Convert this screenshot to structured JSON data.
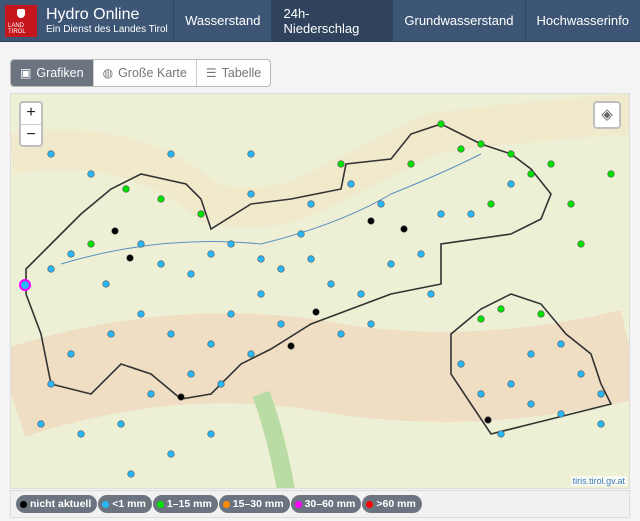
{
  "header": {
    "logo_text": "LAND TIROL",
    "title": "Hydro Online",
    "subtitle": "Ein Dienst des Landes Tirol",
    "nav": [
      {
        "label": "Wasserstand"
      },
      {
        "label": "24h-Niederschlag",
        "active": true
      },
      {
        "label": "Grundwasserstand"
      },
      {
        "label": "Hochwasserinfo"
      }
    ]
  },
  "tabs": [
    {
      "label": "Grafiken",
      "icon": "image-icon",
      "active": true
    },
    {
      "label": "Große Karte",
      "icon": "globe-icon"
    },
    {
      "label": "Tabelle",
      "icon": "list-icon"
    }
  ],
  "map": {
    "zoom_in": "+",
    "zoom_out": "−",
    "attribution": "tiris.tirol.gv.at",
    "layers_icon": "layers-icon"
  },
  "legend": [
    {
      "label": "nicht aktuell",
      "color": "#000000"
    },
    {
      "label": "<1 mm",
      "color": "#29b6f6"
    },
    {
      "label": "1–15 mm",
      "color": "#00e000"
    },
    {
      "label": "15–30 mm",
      "color": "#ff8c00"
    },
    {
      "label": "30–60 mm",
      "color": "#ff00ff"
    },
    {
      "label": ">60 mm",
      "color": "#ff0000"
    }
  ]
}
